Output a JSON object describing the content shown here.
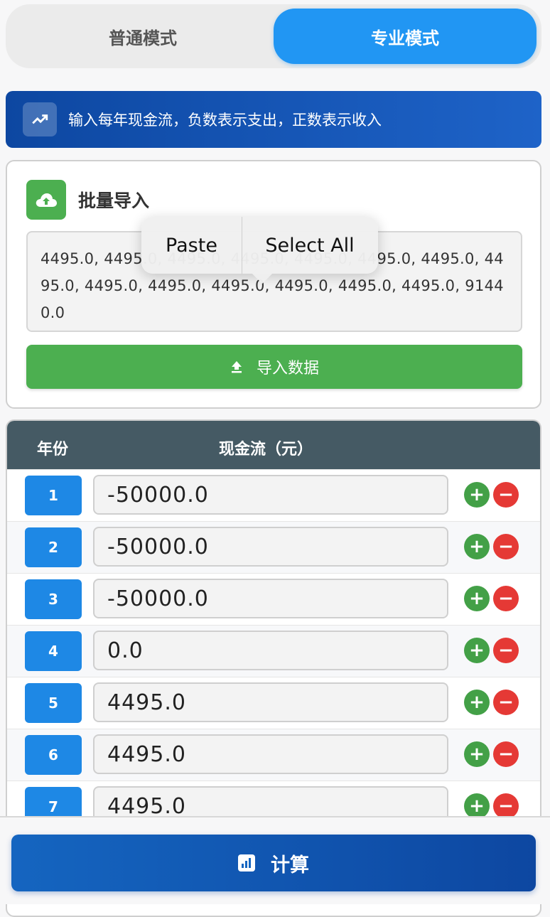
{
  "mode_toggle": {
    "normal_label": "普通模式",
    "pro_label": "专业模式"
  },
  "info_banner": {
    "icon": "trending-up-icon",
    "text": "输入每年现金流，负数表示支出，正数表示收入"
  },
  "import_card": {
    "icon": "cloud-upload-icon",
    "title": "批量导入",
    "textarea_value": "4495.0, 4495.0, 4495.0, 4495.0, 4495.0, 4495.0, 4495.0, 4495.0, 4495.0, 4495.0, 4495.0, 4495.0, 4495.0, 4495.0, 91440.0",
    "button_label": "导入数据",
    "button_icon": "upload-icon"
  },
  "context_menu": {
    "paste": "Paste",
    "select_all": "Select All"
  },
  "table": {
    "year_header": "年份",
    "cash_header": "现金流（元）",
    "rows": [
      {
        "year": "1",
        "value": "-50000.0"
      },
      {
        "year": "2",
        "value": "-50000.0"
      },
      {
        "year": "3",
        "value": "-50000.0"
      },
      {
        "year": "4",
        "value": "0.0"
      },
      {
        "year": "5",
        "value": "4495.0"
      },
      {
        "year": "6",
        "value": "4495.0"
      },
      {
        "year": "7",
        "value": "4495.0"
      }
    ],
    "add_symbol": "+",
    "remove_symbol": "−"
  },
  "calculate": {
    "label": "计算",
    "icon": "bar-chart-icon"
  },
  "colors": {
    "primary": "#2196f3",
    "banner": "#0d47a1",
    "success": "#4caf50",
    "danger": "#e53935",
    "table_header": "#455a64"
  }
}
